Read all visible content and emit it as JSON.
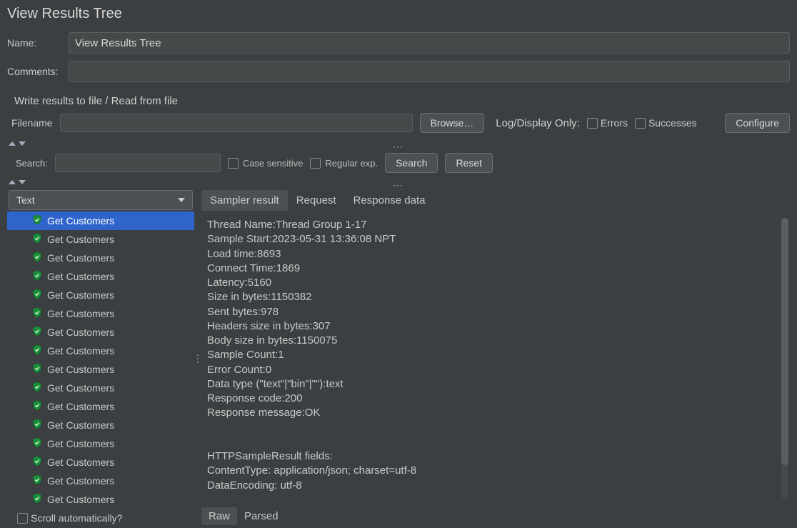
{
  "page_title": "View Results Tree",
  "form": {
    "name_label": "Name:",
    "name_value": "View Results Tree",
    "comments_label": "Comments:",
    "comments_value": ""
  },
  "file_section": {
    "title": "Write results to file / Read from file",
    "filename_label": "Filename",
    "filename_value": "",
    "browse_label": "Browse…",
    "logdisplay_label": "Log/Display Only:",
    "errors_label": "Errors",
    "successes_label": "Successes",
    "configure_label": "Configure"
  },
  "search": {
    "label": "Search:",
    "value": "",
    "case_sensitive_label": "Case sensitive",
    "regex_label": "Regular exp.",
    "search_button": "Search",
    "reset_button": "Reset"
  },
  "view_type_selected": "Text",
  "tree_items": [
    "Get Customers",
    "Get Customers",
    "Get Customers",
    "Get Customers",
    "Get Customers",
    "Get Customers",
    "Get Customers",
    "Get Customers",
    "Get Customers",
    "Get Customers",
    "Get Customers",
    "Get Customers",
    "Get Customers",
    "Get Customers",
    "Get Customers",
    "Get Customers"
  ],
  "tabs": {
    "sampler_result": "Sampler result",
    "request": "Request",
    "response_data": "Response data"
  },
  "sampler_lines": [
    "Thread Name:Thread Group 1-17",
    "Sample Start:2023-05-31 13:36:08 NPT",
    "Load time:8693",
    "Connect Time:1869",
    "Latency:5160",
    "Size in bytes:1150382",
    "Sent bytes:978",
    "Headers size in bytes:307",
    "Body size in bytes:1150075",
    "Sample Count:1",
    "Error Count:0",
    "Data type (\"text\"|\"bin\"|\"\"):text",
    "Response code:200",
    "Response message:OK",
    "",
    "",
    "HTTPSampleResult fields:",
    "ContentType: application/json; charset=utf-8",
    "DataEncoding: utf-8"
  ],
  "bottom_tabs": {
    "raw": "Raw",
    "parsed": "Parsed"
  },
  "scroll_auto_label": "Scroll automatically?"
}
